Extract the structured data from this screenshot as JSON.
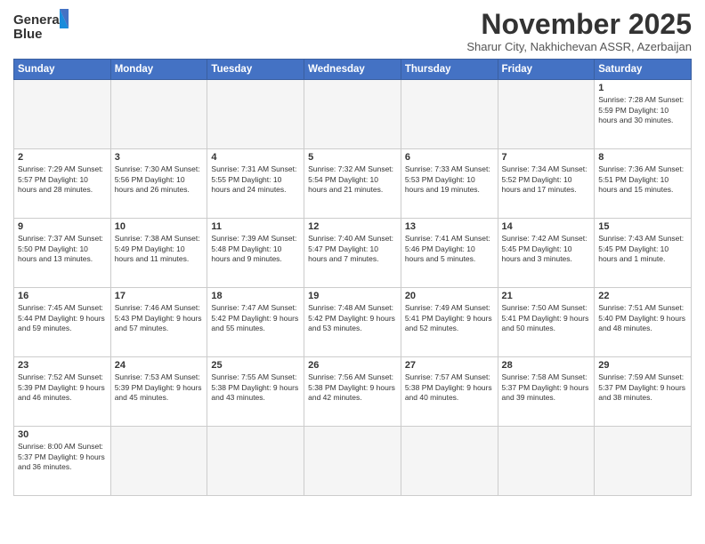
{
  "logo": {
    "line1": "General",
    "line2": "Blue"
  },
  "title": "November 2025",
  "subtitle": "Sharur City, Nakhichevan ASSR, Azerbaijan",
  "days_of_week": [
    "Sunday",
    "Monday",
    "Tuesday",
    "Wednesday",
    "Thursday",
    "Friday",
    "Saturday"
  ],
  "weeks": [
    [
      {
        "day": "",
        "info": ""
      },
      {
        "day": "",
        "info": ""
      },
      {
        "day": "",
        "info": ""
      },
      {
        "day": "",
        "info": ""
      },
      {
        "day": "",
        "info": ""
      },
      {
        "day": "",
        "info": ""
      },
      {
        "day": "1",
        "info": "Sunrise: 7:28 AM\nSunset: 5:59 PM\nDaylight: 10 hours and 30 minutes."
      }
    ],
    [
      {
        "day": "2",
        "info": "Sunrise: 7:29 AM\nSunset: 5:57 PM\nDaylight: 10 hours and 28 minutes."
      },
      {
        "day": "3",
        "info": "Sunrise: 7:30 AM\nSunset: 5:56 PM\nDaylight: 10 hours and 26 minutes."
      },
      {
        "day": "4",
        "info": "Sunrise: 7:31 AM\nSunset: 5:55 PM\nDaylight: 10 hours and 24 minutes."
      },
      {
        "day": "5",
        "info": "Sunrise: 7:32 AM\nSunset: 5:54 PM\nDaylight: 10 hours and 21 minutes."
      },
      {
        "day": "6",
        "info": "Sunrise: 7:33 AM\nSunset: 5:53 PM\nDaylight: 10 hours and 19 minutes."
      },
      {
        "day": "7",
        "info": "Sunrise: 7:34 AM\nSunset: 5:52 PM\nDaylight: 10 hours and 17 minutes."
      },
      {
        "day": "8",
        "info": "Sunrise: 7:36 AM\nSunset: 5:51 PM\nDaylight: 10 hours and 15 minutes."
      }
    ],
    [
      {
        "day": "9",
        "info": "Sunrise: 7:37 AM\nSunset: 5:50 PM\nDaylight: 10 hours and 13 minutes."
      },
      {
        "day": "10",
        "info": "Sunrise: 7:38 AM\nSunset: 5:49 PM\nDaylight: 10 hours and 11 minutes."
      },
      {
        "day": "11",
        "info": "Sunrise: 7:39 AM\nSunset: 5:48 PM\nDaylight: 10 hours and 9 minutes."
      },
      {
        "day": "12",
        "info": "Sunrise: 7:40 AM\nSunset: 5:47 PM\nDaylight: 10 hours and 7 minutes."
      },
      {
        "day": "13",
        "info": "Sunrise: 7:41 AM\nSunset: 5:46 PM\nDaylight: 10 hours and 5 minutes."
      },
      {
        "day": "14",
        "info": "Sunrise: 7:42 AM\nSunset: 5:45 PM\nDaylight: 10 hours and 3 minutes."
      },
      {
        "day": "15",
        "info": "Sunrise: 7:43 AM\nSunset: 5:45 PM\nDaylight: 10 hours and 1 minute."
      }
    ],
    [
      {
        "day": "16",
        "info": "Sunrise: 7:45 AM\nSunset: 5:44 PM\nDaylight: 9 hours and 59 minutes."
      },
      {
        "day": "17",
        "info": "Sunrise: 7:46 AM\nSunset: 5:43 PM\nDaylight: 9 hours and 57 minutes."
      },
      {
        "day": "18",
        "info": "Sunrise: 7:47 AM\nSunset: 5:42 PM\nDaylight: 9 hours and 55 minutes."
      },
      {
        "day": "19",
        "info": "Sunrise: 7:48 AM\nSunset: 5:42 PM\nDaylight: 9 hours and 53 minutes."
      },
      {
        "day": "20",
        "info": "Sunrise: 7:49 AM\nSunset: 5:41 PM\nDaylight: 9 hours and 52 minutes."
      },
      {
        "day": "21",
        "info": "Sunrise: 7:50 AM\nSunset: 5:41 PM\nDaylight: 9 hours and 50 minutes."
      },
      {
        "day": "22",
        "info": "Sunrise: 7:51 AM\nSunset: 5:40 PM\nDaylight: 9 hours and 48 minutes."
      }
    ],
    [
      {
        "day": "23",
        "info": "Sunrise: 7:52 AM\nSunset: 5:39 PM\nDaylight: 9 hours and 46 minutes."
      },
      {
        "day": "24",
        "info": "Sunrise: 7:53 AM\nSunset: 5:39 PM\nDaylight: 9 hours and 45 minutes."
      },
      {
        "day": "25",
        "info": "Sunrise: 7:55 AM\nSunset: 5:38 PM\nDaylight: 9 hours and 43 minutes."
      },
      {
        "day": "26",
        "info": "Sunrise: 7:56 AM\nSunset: 5:38 PM\nDaylight: 9 hours and 42 minutes."
      },
      {
        "day": "27",
        "info": "Sunrise: 7:57 AM\nSunset: 5:38 PM\nDaylight: 9 hours and 40 minutes."
      },
      {
        "day": "28",
        "info": "Sunrise: 7:58 AM\nSunset: 5:37 PM\nDaylight: 9 hours and 39 minutes."
      },
      {
        "day": "29",
        "info": "Sunrise: 7:59 AM\nSunset: 5:37 PM\nDaylight: 9 hours and 38 minutes."
      }
    ],
    [
      {
        "day": "30",
        "info": "Sunrise: 8:00 AM\nSunset: 5:37 PM\nDaylight: 9 hours and 36 minutes."
      },
      {
        "day": "",
        "info": ""
      },
      {
        "day": "",
        "info": ""
      },
      {
        "day": "",
        "info": ""
      },
      {
        "day": "",
        "info": ""
      },
      {
        "day": "",
        "info": ""
      },
      {
        "day": "",
        "info": ""
      }
    ]
  ],
  "colors": {
    "header_bg": "#4472C4",
    "header_text": "#ffffff",
    "border": "#cccccc",
    "empty_bg": "#f5f5f5"
  }
}
